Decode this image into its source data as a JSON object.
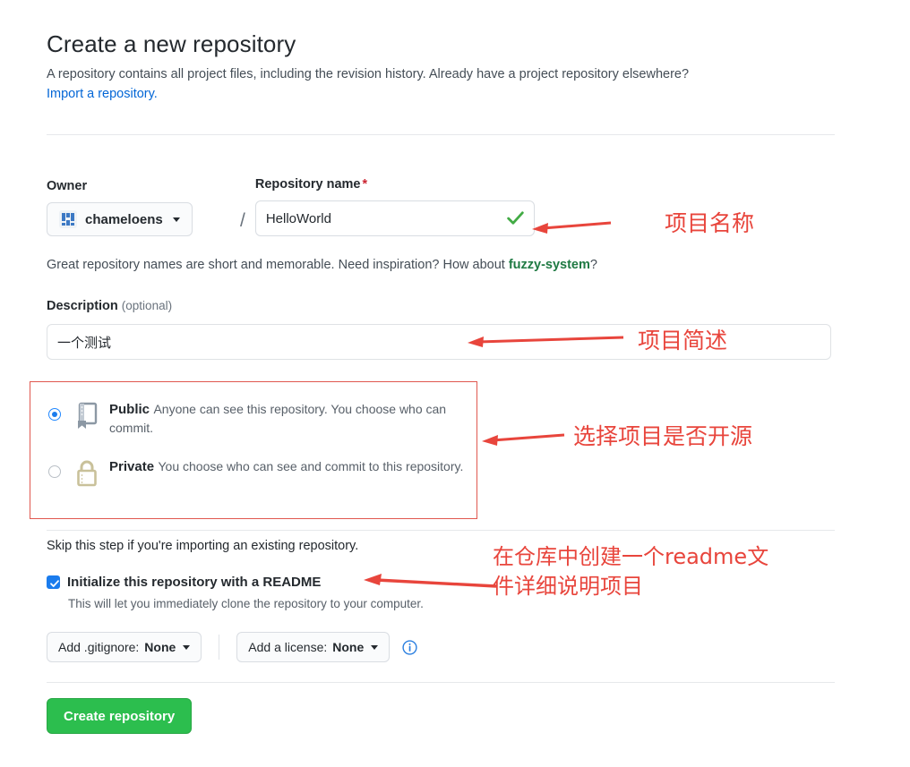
{
  "header": {
    "title": "Create a new repository",
    "subtitle": "A repository contains all project files, including the revision history. Already have a project repository elsewhere?",
    "import_link": "Import a repository."
  },
  "owner": {
    "label": "Owner",
    "name": "chameloens",
    "separator": "/"
  },
  "repository_name": {
    "label": "Repository name",
    "required_mark": "*",
    "value": "HelloWorld",
    "placeholder": "",
    "valid_icon": "check-icon",
    "hint_prefix": "Great repository names are short and memorable. Need inspiration? How about ",
    "hint_suggestion": "fuzzy-system",
    "hint_suffix": "?"
  },
  "description": {
    "label": "Description",
    "optional": "(optional)",
    "value": "一个测试",
    "placeholder": ""
  },
  "visibility": {
    "options": [
      {
        "name": "Public",
        "description": "Anyone can see this repository. You choose who can commit.",
        "selected": true,
        "icon": "repo-book-icon"
      },
      {
        "name": "Private",
        "description": "You choose who can see and commit to this repository.",
        "selected": false,
        "icon": "lock-icon"
      }
    ],
    "highlight_color": "#e0584f"
  },
  "initialize": {
    "skip_text": "Skip this step if you're importing an existing repository.",
    "readme_label": "Initialize this repository with a README",
    "readme_sub": "This will let you immediately clone the repository to your computer.",
    "readme_checked": true
  },
  "extras": {
    "gitignore_prefix": "Add .gitignore: ",
    "gitignore_value": "None",
    "license_prefix": "Add a license: ",
    "license_value": "None",
    "info_icon": "info-circle-icon"
  },
  "submit": {
    "label": "Create repository",
    "color": "#2cbe4e"
  },
  "annotations": {
    "color": "#e8453c",
    "items": [
      {
        "text": "项目名称",
        "target": "repository-name-input"
      },
      {
        "text": "项目简述",
        "target": "description-input"
      },
      {
        "text": "选择项目是否开源",
        "target": "visibility-box"
      },
      {
        "text": "在仓库中创建一个readme文\n件详细说明项目",
        "target": "readme-checkbox"
      }
    ],
    "a1": "项目名称",
    "a2": "项目简述",
    "a3": "选择项目是否开源",
    "a4": "在仓库中创建一个readme文\n件详细说明项目"
  }
}
